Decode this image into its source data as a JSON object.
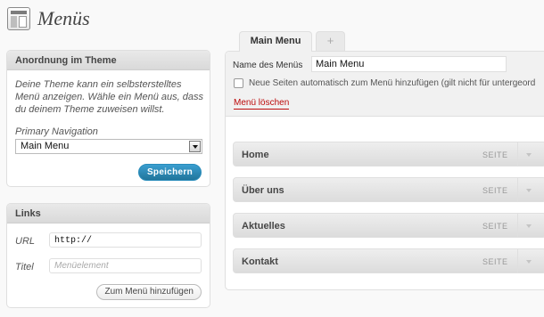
{
  "header": {
    "title": "Menüs",
    "icon": "menus-icon"
  },
  "theme_box": {
    "heading": "Anordnung im Theme",
    "description": "Deine Theme kann ein selbsterstelltes Menü anzeigen. Wähle ein Menü aus, dass du deinem Theme zuweisen willst.",
    "location_label": "Primary Navigation",
    "selected_menu": "Main Menu",
    "save_label": "Speichern"
  },
  "links_box": {
    "heading": "Links",
    "url_label": "URL",
    "url_value": "http://",
    "title_label": "Titel",
    "title_placeholder": "Menüelement",
    "add_label": "Zum Menü hinzufügen"
  },
  "tabs": {
    "active": "Main Menu",
    "add": "+"
  },
  "editor": {
    "name_label": "Name des Menüs",
    "name_value": "Main Menu",
    "auto_add_label": "Neue Seiten automatisch zum Menü hinzufügen (gilt nicht für untergeord",
    "delete_label": "Menü löschen"
  },
  "menu_items": [
    {
      "title": "Home",
      "type": "SEITE"
    },
    {
      "title": "Über uns",
      "type": "SEITE"
    },
    {
      "title": "Aktuelles",
      "type": "SEITE"
    },
    {
      "title": "Kontakt",
      "type": "SEITE"
    }
  ],
  "colors": {
    "primary_button": "#21759b",
    "delete_link": "#bc0b0b",
    "background": "#f9f9f9"
  }
}
